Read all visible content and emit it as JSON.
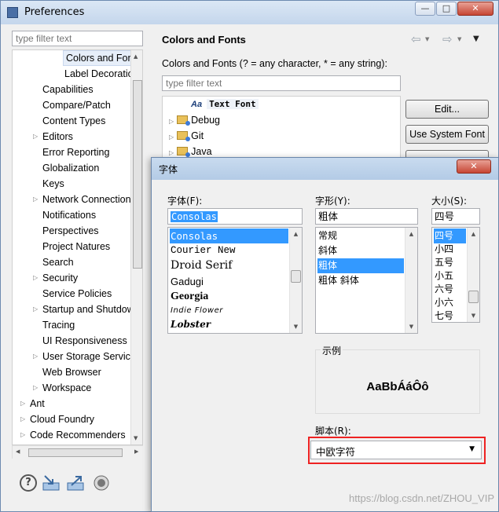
{
  "window": {
    "title": "Preferences"
  },
  "left": {
    "filter_placeholder": "type filter text",
    "tree": [
      {
        "label": "Colors and Fonts",
        "level": 2,
        "selected": true
      },
      {
        "label": "Label Decorations",
        "level": 2
      },
      {
        "label": "Capabilities",
        "level": 1
      },
      {
        "label": "Compare/Patch",
        "level": 1
      },
      {
        "label": "Content Types",
        "level": 1
      },
      {
        "label": "Editors",
        "level": 1,
        "expander": true
      },
      {
        "label": "Error Reporting",
        "level": 1
      },
      {
        "label": "Globalization",
        "level": 1
      },
      {
        "label": "Keys",
        "level": 1
      },
      {
        "label": "Network Connections",
        "level": 1,
        "expander": true
      },
      {
        "label": "Notifications",
        "level": 1
      },
      {
        "label": "Perspectives",
        "level": 1
      },
      {
        "label": "Project Natures",
        "level": 1
      },
      {
        "label": "Search",
        "level": 1
      },
      {
        "label": "Security",
        "level": 1,
        "expander": true
      },
      {
        "label": "Service Policies",
        "level": 1
      },
      {
        "label": "Startup and Shutdown",
        "level": 1,
        "expander": true
      },
      {
        "label": "Tracing",
        "level": 1
      },
      {
        "label": "UI Responsiveness",
        "level": 1
      },
      {
        "label": "User Storage Service",
        "level": 1,
        "expander": true
      },
      {
        "label": "Web Browser",
        "level": 1
      },
      {
        "label": "Workspace",
        "level": 1,
        "expander": true
      },
      {
        "label": "Ant",
        "level": 0,
        "expander": true
      },
      {
        "label": "Cloud Foundry",
        "level": 0,
        "expander": true
      },
      {
        "label": "Code Recommenders",
        "level": 0,
        "expander": true
      }
    ]
  },
  "right": {
    "title": "Colors and Fonts",
    "description": "Colors and Fonts (? = any character, * = any string):",
    "filter_placeholder": "type filter text",
    "tree": [
      {
        "label": "Text Font",
        "icon": "font-icon"
      },
      {
        "label": "Debug",
        "icon": "folder-icon"
      },
      {
        "label": "Git",
        "icon": "folder-icon"
      },
      {
        "label": "Java",
        "icon": "folder-icon"
      }
    ],
    "buttons": {
      "edit": "Edit...",
      "use_system_font": "Use System Font"
    }
  },
  "font_dialog": {
    "title": "字体",
    "font_label": "字体(F):",
    "font_value": "Consolas",
    "fonts": [
      "Consolas",
      "Courier New",
      "Droid Serif",
      "Gadugi",
      "Georgia",
      "Indie Flower",
      "Lobster"
    ],
    "selected_font": "Consolas",
    "style_label": "字形(Y):",
    "style_value": "粗体",
    "styles": [
      "常规",
      "斜体",
      "粗体",
      "粗体 斜体"
    ],
    "selected_style": "粗体",
    "size_label": "大小(S):",
    "size_value": "四号",
    "sizes": [
      "四号",
      "小四",
      "五号",
      "小五",
      "六号",
      "小六",
      "七号"
    ],
    "selected_size": "四号",
    "sample_label": "示例",
    "sample_text": "AaBbÁáÔô",
    "script_label": "脚本(R):",
    "script_value": "中欧字符"
  },
  "watermark": "https://blog.csdn.net/ZHOU_VIP",
  "colors": {
    "selection": "#3399ff",
    "highlight_box": "#ee2222"
  }
}
